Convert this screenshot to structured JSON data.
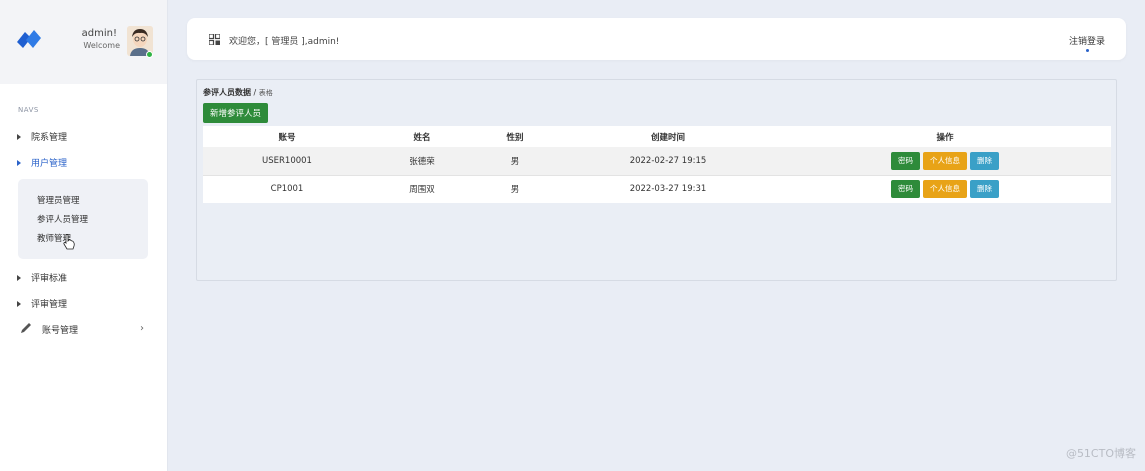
{
  "sidebar": {
    "user": {
      "name": "admin!",
      "welcome": "Welcome"
    },
    "section_title": "NAVS",
    "items": [
      {
        "label": "院系管理"
      },
      {
        "label": "用户管理"
      },
      {
        "label": "评审标准"
      },
      {
        "label": "评审管理"
      },
      {
        "label": "账号管理"
      }
    ],
    "submenu": [
      {
        "label": "管理员管理"
      },
      {
        "label": "参评人员管理"
      },
      {
        "label": "教师管理"
      }
    ]
  },
  "header": {
    "welcome": "欢迎您，[ 管理员 ],admin!",
    "logout": "注销登录"
  },
  "panel": {
    "breadcrumb_main": "参评人员数据",
    "breadcrumb_sep": " / ",
    "breadcrumb_sub": "表格",
    "add_button": "新增参评人员"
  },
  "table": {
    "headers": [
      "账号",
      "姓名",
      "性别",
      "创建时间",
      "操作"
    ],
    "rows": [
      {
        "account": "USER10001",
        "name": "张德荣",
        "gender": "男",
        "created": "2022-02-27 19:15"
      },
      {
        "account": "CP1001",
        "name": "周围双",
        "gender": "男",
        "created": "2022-03-27 19:31"
      }
    ],
    "actions": [
      "密码",
      "个人信息",
      "删除"
    ]
  },
  "watermark": "@51CTO博客",
  "colors": {
    "green": "#2e8b3a",
    "orange": "#e8a317",
    "blue": "#3aa0c7",
    "active_nav": "#2a62c9"
  }
}
